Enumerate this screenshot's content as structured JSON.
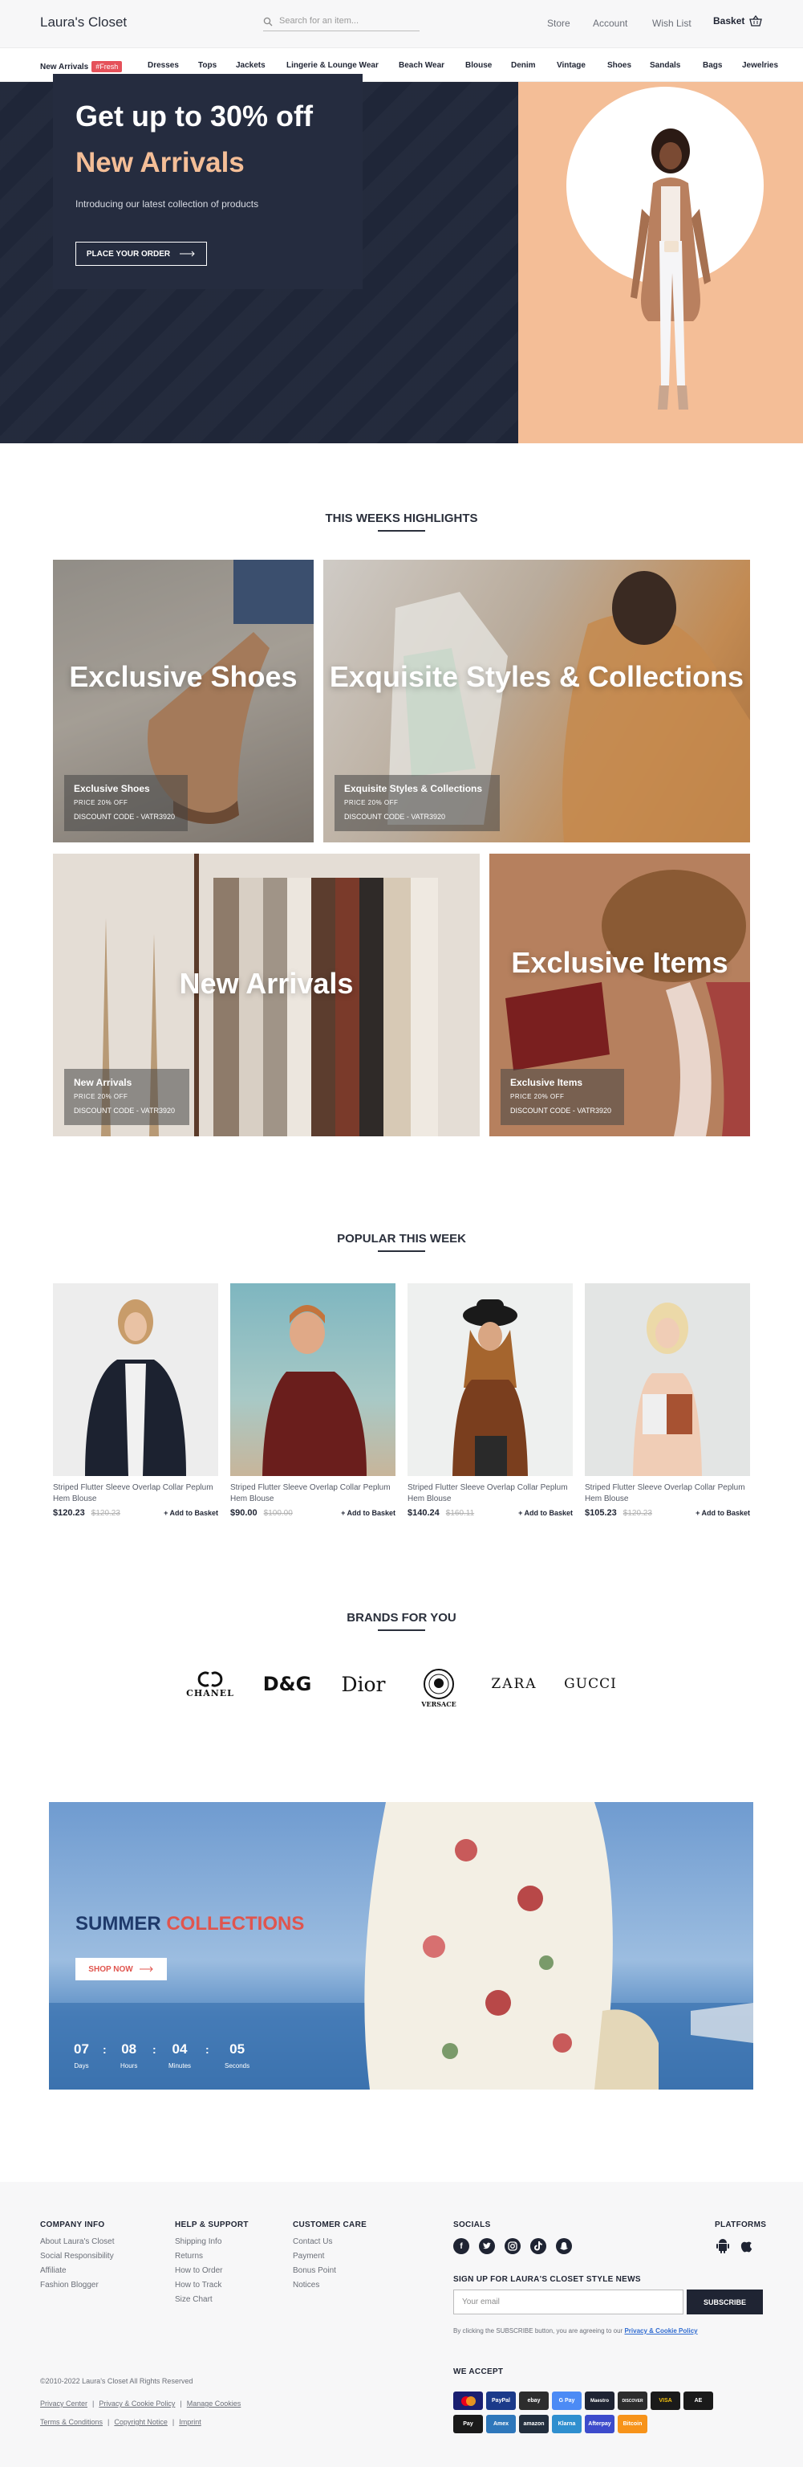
{
  "header": {
    "logo": "Laura's Closet",
    "search_placeholder": "Search for an item...",
    "nav": [
      "Store",
      "Account",
      "Wish List"
    ],
    "basket_label": "Basket"
  },
  "categories": {
    "new_arrivals": "New Arrivals",
    "fresh_badge": "#Fresh",
    "items": [
      "Dresses",
      "Tops",
      "Jackets",
      "Lingerie & Lounge Wear",
      "Beach Wear",
      "Blouse",
      "Denim",
      "Vintage",
      "Shoes",
      "Sandals",
      "Bags",
      "Jewelries"
    ]
  },
  "hero": {
    "headline": "Get up to 30% off",
    "subheadline": "New Arrivals",
    "tagline": "Introducing our latest collection of products",
    "cta": "PLACE YOUR ORDER",
    "colors": {
      "dark": "#1f2638",
      "accent": "#f4be97"
    }
  },
  "highlights": {
    "title": "THIS WEEKS HIGHLIGHTS",
    "tiles": [
      {
        "big": "Exclusive Shoes",
        "card_title": "Exclusive Shoes",
        "price": "PRICE 20% OFF",
        "code": "DISCOUNT CODE - VATR3920"
      },
      {
        "big": "Exquisite Styles & Collections",
        "card_title": "Exquisite Styles & Collections",
        "price": "PRICE 20% OFF",
        "code": "DISCOUNT CODE - VATR3920"
      },
      {
        "big": "New Arrivals",
        "card_title": "New Arrivals",
        "price": "PRICE 20% OFF",
        "code": "DISCOUNT CODE - VATR3920"
      },
      {
        "big": "Exclusive Items",
        "card_title": "Exclusive Items",
        "price": "PRICE 20% OFF",
        "code": "DISCOUNT CODE - VATR3920"
      }
    ]
  },
  "popular": {
    "title": "POPULAR THIS WEEK",
    "add_label": "+ Add to Basket",
    "products": [
      {
        "name": "Striped Flutter Sleeve Overlap Collar Peplum Hem Blouse",
        "price": "$120.23",
        "old_price": "$120.23"
      },
      {
        "name": "Striped Flutter Sleeve Overlap Collar Peplum Hem Blouse",
        "price": "$90.00",
        "old_price": "$100.00"
      },
      {
        "name": "Striped Flutter Sleeve Overlap Collar Peplum Hem Blouse",
        "price": "$140.24",
        "old_price": "$160.11"
      },
      {
        "name": "Striped Flutter Sleeve Overlap Collar Peplum Hem Blouse",
        "price": "$105.23",
        "old_price": "$120.23"
      }
    ]
  },
  "brands": {
    "title": "BRANDS FOR YOU",
    "items": [
      "CHANEL",
      "D&G",
      "Dior",
      "VERSACE",
      "ZARA",
      "GUCCI"
    ]
  },
  "summer": {
    "word1": "SUMMER",
    "word2": "COLLECTIONS",
    "cta": "SHOP NOW",
    "countdown": [
      {
        "value": "07",
        "label": "Days"
      },
      {
        "value": "08",
        "label": "Hours"
      },
      {
        "value": "04",
        "label": "Minutes"
      },
      {
        "value": "05",
        "label": "Seconds"
      }
    ],
    "colors": {
      "navy": "#1f3a6b",
      "red": "#e0554e"
    }
  },
  "footer": {
    "company": {
      "title": "COMPANY INFO",
      "links": [
        "About Laura's Closet",
        "Social Responsibility",
        "Affiliate",
        "Fashion Blogger"
      ]
    },
    "help": {
      "title": "HELP & SUPPORT",
      "links": [
        "Shipping Info",
        "Returns",
        "How to Order",
        "How to Track",
        "Size Chart"
      ]
    },
    "care": {
      "title": "CUSTOMER CARE",
      "links": [
        "Contact Us",
        "Payment",
        "Bonus Point",
        "Notices"
      ]
    },
    "socials_title": "SOCIALS",
    "platforms_title": "PLATFORMS",
    "newsletter_title": "SIGN UP FOR LAURA'S CLOSET STYLE NEWS",
    "email_placeholder": "Your email",
    "subscribe": "SUBSCRIBE",
    "consent_prefix": "By clicking the SUBSCRIBE button, you are agreeing to our",
    "consent_link": "Privacy & Cookie Policy",
    "copyright": "©2010-2022 Laura's Closet All Rights Reserved",
    "legal1": [
      "Privacy Center",
      "Privacy & Cookie Policy",
      "Manage Cookies"
    ],
    "legal2": [
      "Terms & Conditions",
      "Copyright Notice",
      "Imprint"
    ],
    "accept_title": "WE ACCEPT",
    "payments": [
      "Mastercard",
      "PayPal",
      "ebay",
      "G Pay",
      "Maestro",
      "DISCOVER",
      "VISA",
      "AE",
      "Pay",
      "Amex",
      "amazon",
      "Klarna",
      "Afterpay",
      "Bitcoin"
    ]
  }
}
